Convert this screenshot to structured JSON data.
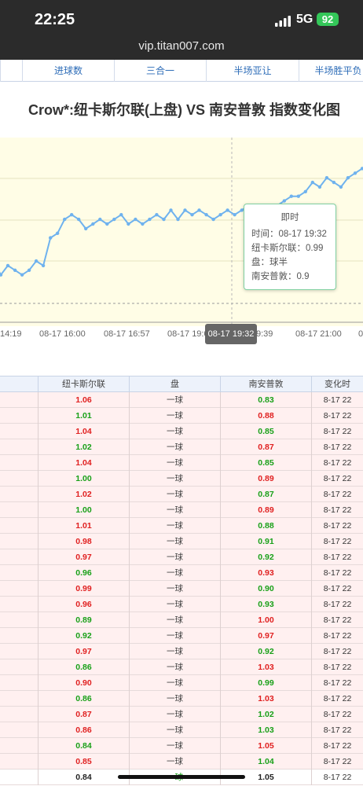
{
  "status": {
    "time": "22:25",
    "network": "5G",
    "battery": "92"
  },
  "browser": {
    "url": "vip.titan007.com"
  },
  "tabs": [
    "进球数",
    "三合一",
    "半场亚让",
    "半场胜平负"
  ],
  "title": "Crow*:纽卡斯尔联(上盘) VS 南安普敦 指数变化图",
  "chart_data": {
    "type": "line",
    "title": "Crow*:纽卡斯尔联(上盘) VS 南安普敦 指数变化图",
    "x_ticks": [
      "14:19",
      "08-17 16:00",
      "08-17 16:57",
      "08-17 19:0",
      "08-17 19:32",
      "9:39",
      "08-17 21:00",
      "0"
    ],
    "x_cursor_label": "08-17 19:32",
    "series": [
      {
        "name": "纽卡斯尔联",
        "values": [
          0.87,
          0.84,
          0.86,
          0.85,
          0.84,
          0.85,
          0.87,
          0.86,
          0.92,
          0.93,
          0.96,
          0.97,
          0.96,
          0.94,
          0.95,
          0.96,
          0.95,
          0.96,
          0.97,
          0.95,
          0.96,
          0.95,
          0.96,
          0.97,
          0.96,
          0.98,
          0.96,
          0.98,
          0.97,
          0.98,
          0.97,
          0.96,
          0.97,
          0.98,
          0.97,
          0.98,
          0.99,
          0.98,
          0.99,
          0.98,
          0.99,
          1.0,
          1.01,
          1.01,
          1.02,
          1.04,
          1.03,
          1.05,
          1.04,
          1.03,
          1.05,
          1.06,
          1.07,
          1.06
        ]
      }
    ],
    "color": "#6fb2ee",
    "grid": true
  },
  "tooltip": {
    "title": "即时",
    "time": "时间：08-17 19:32",
    "home": "纽卡斯尔联：0.99",
    "pan": "盘：球半",
    "away": "南安普敦：0.9"
  },
  "table": {
    "headers": [
      "",
      "纽卡斯尔联",
      "盘",
      "南安普敦",
      "变化时"
    ],
    "rows": [
      {
        "home": "1.06",
        "hc": "red",
        "pan": "一球",
        "away": "0.83",
        "ac": "green",
        "time": "8-17 22"
      },
      {
        "home": "1.01",
        "hc": "green",
        "pan": "一球",
        "away": "0.88",
        "ac": "red",
        "time": "8-17 22"
      },
      {
        "home": "1.04",
        "hc": "red",
        "pan": "一球",
        "away": "0.85",
        "ac": "green",
        "time": "8-17 22"
      },
      {
        "home": "1.02",
        "hc": "green",
        "pan": "一球",
        "away": "0.87",
        "ac": "red",
        "time": "8-17 22"
      },
      {
        "home": "1.04",
        "hc": "red",
        "pan": "一球",
        "away": "0.85",
        "ac": "green",
        "time": "8-17 22"
      },
      {
        "home": "1.00",
        "hc": "green",
        "pan": "一球",
        "away": "0.89",
        "ac": "red",
        "time": "8-17 22"
      },
      {
        "home": "1.02",
        "hc": "red",
        "pan": "一球",
        "away": "0.87",
        "ac": "green",
        "time": "8-17 22"
      },
      {
        "home": "1.00",
        "hc": "green",
        "pan": "一球",
        "away": "0.89",
        "ac": "red",
        "time": "8-17 22"
      },
      {
        "home": "1.01",
        "hc": "red",
        "pan": "一球",
        "away": "0.88",
        "ac": "green",
        "time": "8-17 22"
      },
      {
        "home": "0.98",
        "hc": "red",
        "pan": "一球",
        "away": "0.91",
        "ac": "green",
        "time": "8-17 22"
      },
      {
        "home": "0.97",
        "hc": "red",
        "pan": "一球",
        "away": "0.92",
        "ac": "green",
        "time": "8-17 22"
      },
      {
        "home": "0.96",
        "hc": "green",
        "pan": "一球",
        "away": "0.93",
        "ac": "red",
        "time": "8-17 22"
      },
      {
        "home": "0.99",
        "hc": "red",
        "pan": "一球",
        "away": "0.90",
        "ac": "green",
        "time": "8-17 22"
      },
      {
        "home": "0.96",
        "hc": "red",
        "pan": "一球",
        "away": "0.93",
        "ac": "green",
        "time": "8-17 22"
      },
      {
        "home": "0.89",
        "hc": "green",
        "pan": "一球",
        "away": "1.00",
        "ac": "red",
        "time": "8-17 22"
      },
      {
        "home": "0.92",
        "hc": "green",
        "pan": "一球",
        "away": "0.97",
        "ac": "red",
        "time": "8-17 22"
      },
      {
        "home": "0.97",
        "hc": "red",
        "pan": "一球",
        "away": "0.92",
        "ac": "green",
        "time": "8-17 22"
      },
      {
        "home": "0.86",
        "hc": "green",
        "pan": "一球",
        "away": "1.03",
        "ac": "red",
        "time": "8-17 22"
      },
      {
        "home": "0.90",
        "hc": "red",
        "pan": "一球",
        "away": "0.99",
        "ac": "green",
        "time": "8-17 22"
      },
      {
        "home": "0.86",
        "hc": "green",
        "pan": "一球",
        "away": "1.03",
        "ac": "red",
        "time": "8-17 22"
      },
      {
        "home": "0.87",
        "hc": "red",
        "pan": "一球",
        "away": "1.02",
        "ac": "green",
        "time": "8-17 22"
      },
      {
        "home": "0.86",
        "hc": "red",
        "pan": "一球",
        "away": "1.03",
        "ac": "green",
        "time": "8-17 22"
      },
      {
        "home": "0.84",
        "hc": "green",
        "pan": "一球",
        "away": "1.05",
        "ac": "red",
        "time": "8-17 22"
      },
      {
        "home": "0.85",
        "hc": "red",
        "pan": "一球",
        "away": "1.04",
        "ac": "green",
        "time": "8-17 22"
      },
      {
        "home": "0.84",
        "hc": "black",
        "pan": "一球",
        "away": "1.05",
        "ac": "black",
        "time": "8-17 22"
      }
    ]
  }
}
